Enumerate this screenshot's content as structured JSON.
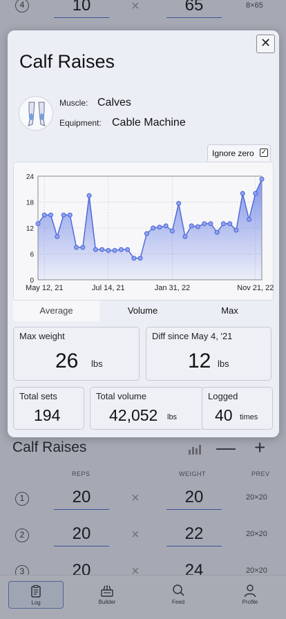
{
  "background": {
    "top_row": {
      "set_number": "4",
      "reps": "10",
      "weight": "65",
      "prev": "8×65"
    },
    "exercise_title": "Calf Raises",
    "column_headers": {
      "reps": "REPS",
      "weight": "WEIGHT",
      "prev": "PREV"
    },
    "sets": [
      {
        "number": "1",
        "reps": "20",
        "weight": "20",
        "prev": "20×20"
      },
      {
        "number": "2",
        "reps": "20",
        "weight": "22",
        "prev": "20×20"
      },
      {
        "number": "3",
        "reps": "20",
        "weight": "24",
        "prev": "20×20"
      }
    ],
    "minus_label": "—",
    "plus_label": "+",
    "x_symbol": "×"
  },
  "nav": {
    "items": [
      {
        "label": "Log",
        "icon": "clipboard-icon",
        "active": true
      },
      {
        "label": "Builder",
        "icon": "builder-icon",
        "active": false
      },
      {
        "label": "Feed",
        "icon": "search-icon",
        "active": false
      },
      {
        "label": "Profile",
        "icon": "person-icon",
        "active": false
      }
    ]
  },
  "modal": {
    "title": "Calf Raises",
    "close_label": "✕",
    "muscle_label": "Muscle:",
    "muscle_value": "Calves",
    "equipment_label": "Equipment:",
    "equipment_value": "Cable Machine",
    "ignore_zero_label": "Ignore zero",
    "ignore_zero_checked": true,
    "tabs": [
      {
        "label": "Average",
        "active": true
      },
      {
        "label": "Volume",
        "active": false
      },
      {
        "label": "Max",
        "active": false
      }
    ],
    "stats": {
      "max_weight": {
        "label": "Max weight",
        "value": "26",
        "unit": "lbs"
      },
      "diff_since": {
        "label": "Diff since May 4, '21",
        "value": "12",
        "unit": "lbs"
      },
      "total_sets": {
        "label": "Total sets",
        "value": "194"
      },
      "total_volume": {
        "label": "Total volume",
        "value": "42,052",
        "unit": "lbs"
      },
      "logged": {
        "label": "Logged",
        "value": "40",
        "unit": "times"
      }
    }
  },
  "chart_data": {
    "type": "area",
    "title": "",
    "xlabel": "",
    "ylabel": "",
    "ylim": [
      0,
      24
    ],
    "y_ticks": [
      0,
      6,
      12,
      18,
      24
    ],
    "x_ticks": [
      "May 12, 21",
      "Jul 14, 21",
      "Jan 31, 22",
      "Nov 21, 22"
    ],
    "grid": true,
    "series_color": "#4a63d6",
    "fill_color": "#6f86e6",
    "series": [
      {
        "values": [
          13,
          15,
          15,
          10,
          15,
          15,
          7.5,
          7.5,
          19.5,
          7,
          7,
          6.8,
          6.8,
          7,
          7,
          5,
          5,
          10.7,
          12,
          12.2,
          12.5,
          11.3,
          17.7,
          10,
          12.5,
          12.3,
          13,
          13,
          11,
          13,
          13,
          11.5,
          20,
          14,
          20,
          23.3
        ]
      }
    ]
  }
}
